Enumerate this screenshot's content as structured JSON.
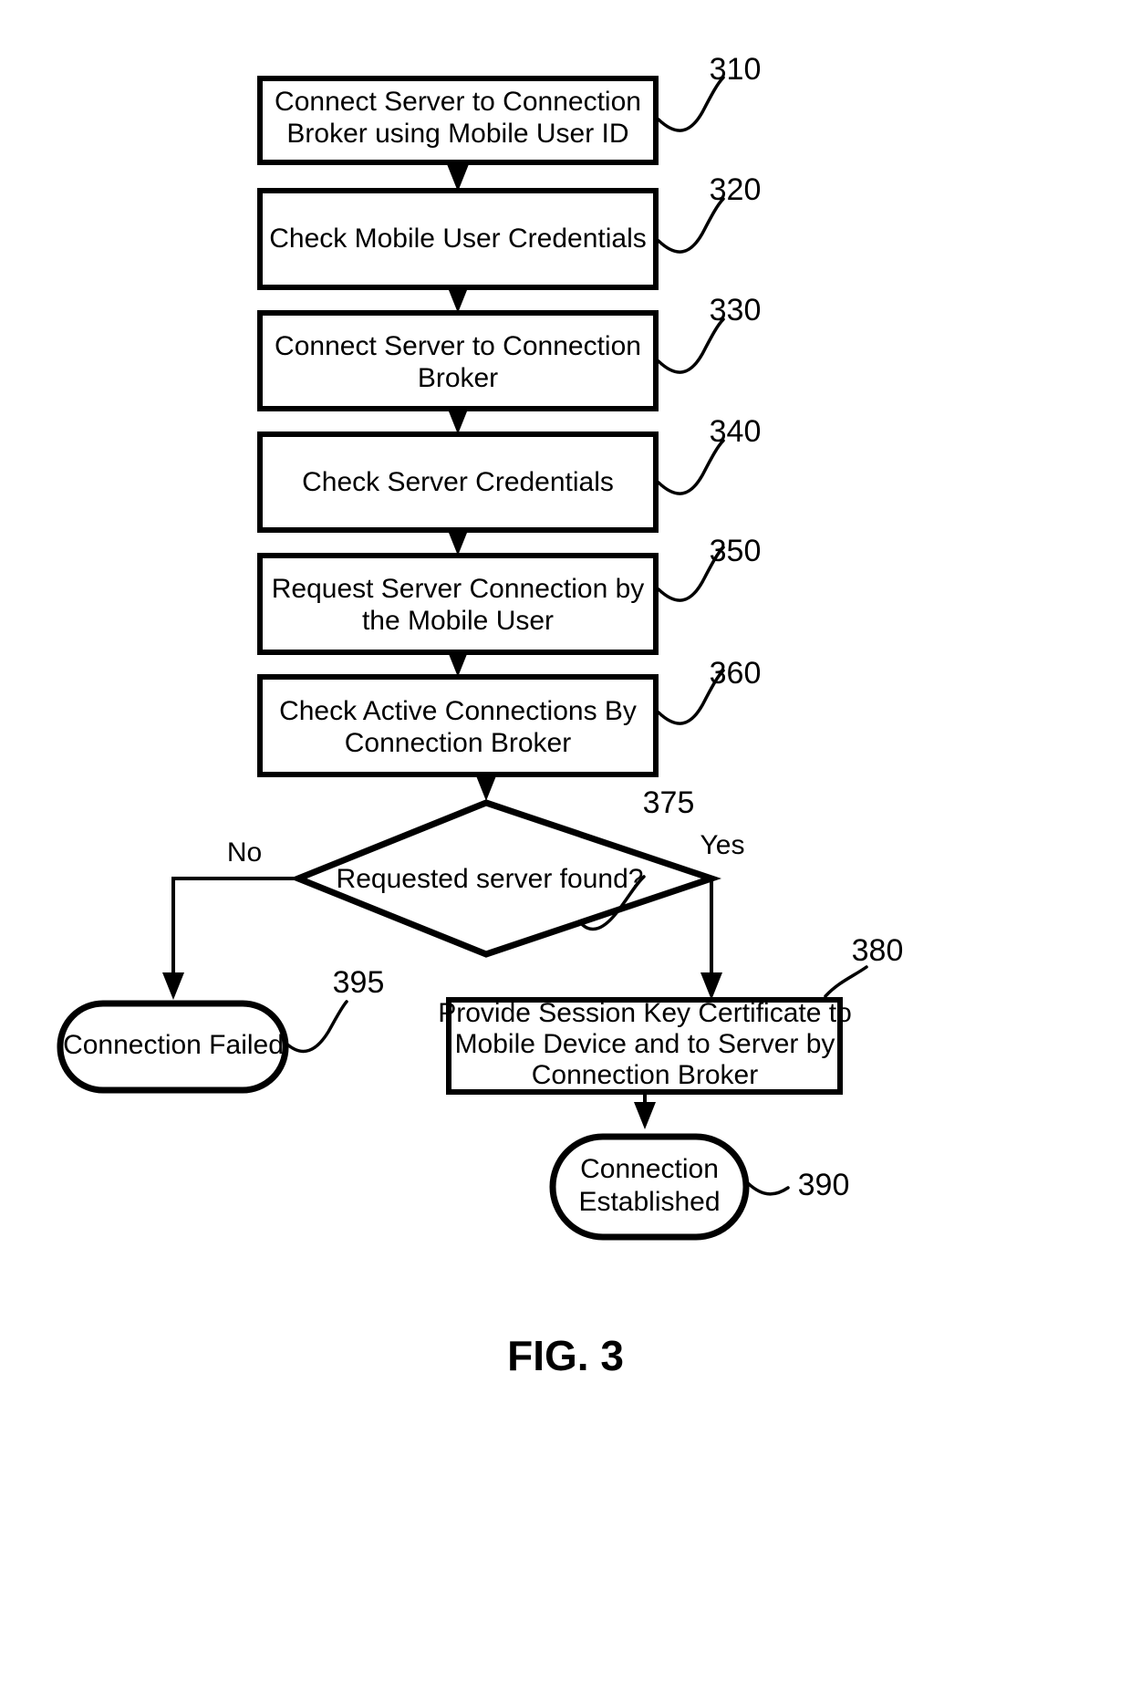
{
  "figure": {
    "caption": "FIG. 3",
    "background_color": "#ffffff",
    "ink_color": "#000000"
  },
  "nodes": [
    {
      "id": "n310",
      "ref": "310",
      "shape": "process",
      "lines": [
        "Connect Server to Connection",
        "Broker using Mobile User ID"
      ]
    },
    {
      "id": "n320",
      "ref": "320",
      "shape": "process",
      "lines": [
        "Check Mobile User Credentials"
      ]
    },
    {
      "id": "n330",
      "ref": "330",
      "shape": "process",
      "lines": [
        "Connect Server to Connection",
        "Broker"
      ]
    },
    {
      "id": "n340",
      "ref": "340",
      "shape": "process",
      "lines": [
        "Check Server Credentials"
      ]
    },
    {
      "id": "n350",
      "ref": "350",
      "shape": "process",
      "lines": [
        "Request Server Connection by",
        "the Mobile User"
      ]
    },
    {
      "id": "n360",
      "ref": "360",
      "shape": "process",
      "lines": [
        "Check Active Connections By",
        "Connection Broker"
      ]
    },
    {
      "id": "n375",
      "ref": "375",
      "shape": "decision",
      "lines": [
        "Requested server found?"
      ]
    },
    {
      "id": "n380",
      "ref": "380",
      "shape": "process",
      "lines": [
        "Provide Session Key Certificate to",
        "Mobile Device and to Server by",
        "Connection Broker"
      ]
    },
    {
      "id": "n390",
      "ref": "390",
      "shape": "terminal",
      "lines": [
        "Connection",
        "Established"
      ]
    },
    {
      "id": "n395",
      "ref": "395",
      "shape": "terminal",
      "lines": [
        "Connection Failed"
      ]
    }
  ],
  "branch_labels": {
    "no": "No",
    "yes": "Yes"
  }
}
